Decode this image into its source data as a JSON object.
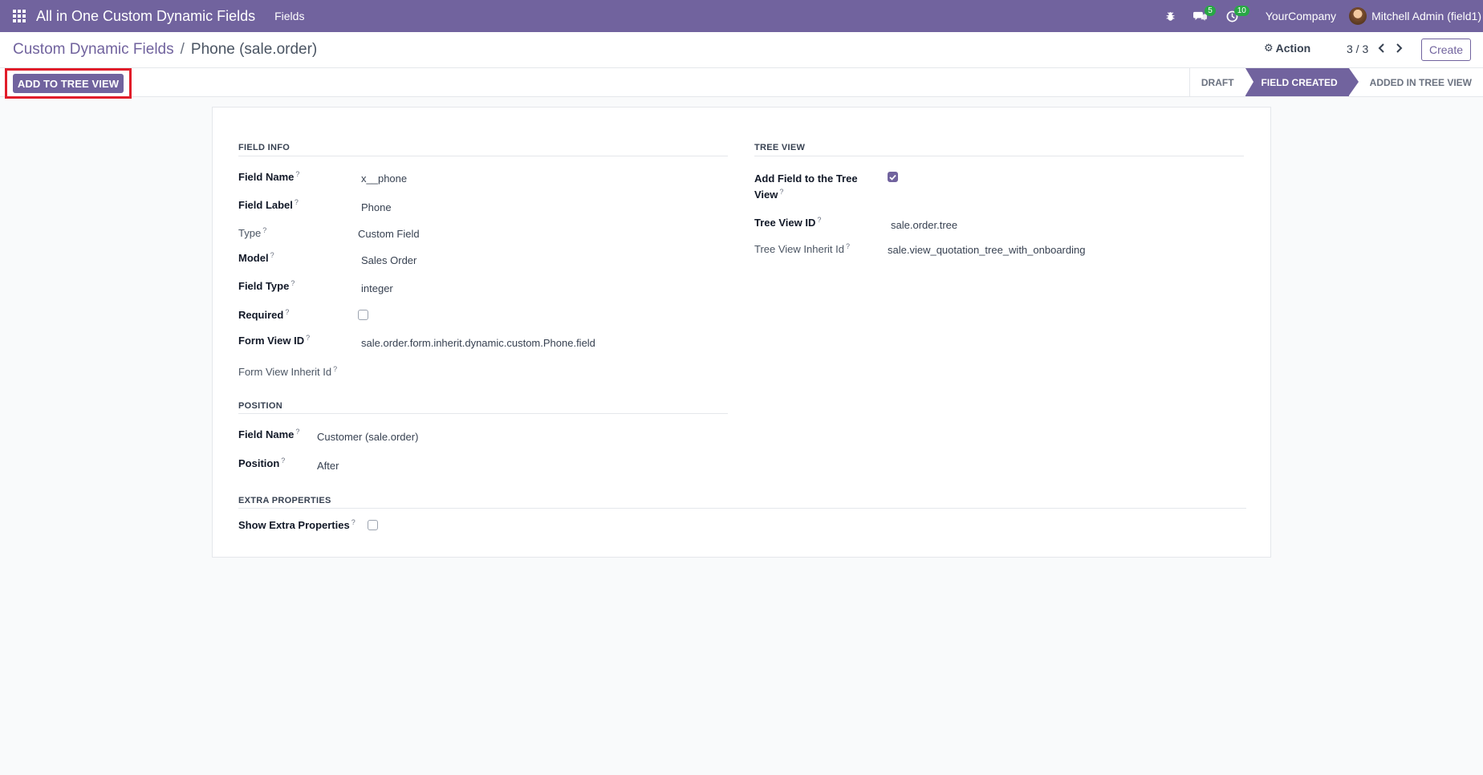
{
  "topbar": {
    "app_title": "All in One Custom Dynamic Fields",
    "menu": "Fields",
    "messages_count": "5",
    "activities_count": "10",
    "company": "YourCompany",
    "user": "Mitchell Admin (field1)"
  },
  "control": {
    "breadcrumb_root": "Custom Dynamic Fields",
    "breadcrumb_sep": "/",
    "breadcrumb_current": "Phone (sale.order)",
    "action_label": "Action",
    "pager": "3 / 3",
    "create_label": "Create"
  },
  "statusbar": {
    "button_label": "ADD TO TREE VIEW",
    "stages": [
      "DRAFT",
      "FIELD CREATED",
      "ADDED IN TREE VIEW"
    ],
    "current_stage": "FIELD CREATED"
  },
  "form": {
    "field_info": {
      "title": "FIELD INFO",
      "field_name_label": "Field Name",
      "field_name": "x__phone",
      "field_label_label": "Field Label",
      "field_label": "Phone",
      "type_label": "Type",
      "type": "Custom Field",
      "model_label": "Model",
      "model": "Sales Order",
      "field_type_label": "Field Type",
      "field_type": "integer",
      "required_label": "Required",
      "required": false,
      "form_view_id_label": "Form View ID",
      "form_view_id": "sale.order.form.inherit.dynamic.custom.Phone.field",
      "form_view_inherit_label": "Form View Inherit Id"
    },
    "tree_view": {
      "title": "TREE VIEW",
      "add_field_label_1": "Add Field to the Tree",
      "add_field_label_2": "View",
      "add_field": true,
      "tree_view_id_label": "Tree View ID",
      "tree_view_id": "sale.order.tree",
      "tree_view_inherit_label": "Tree View Inherit Id",
      "tree_view_inherit": "sale.view_quotation_tree_with_onboarding"
    },
    "position": {
      "title": "POSITION",
      "field_name_label": "Field Name",
      "field_name": "Customer (sale.order)",
      "position_label": "Position",
      "position": "After"
    },
    "extra": {
      "title": "EXTRA PROPERTIES",
      "show_label": "Show Extra Properties",
      "show": false
    },
    "tooltip_mark": "?"
  },
  "colors": {
    "brand": "#71639e",
    "badge": "#28a745",
    "highlight": "#e11d2a"
  }
}
